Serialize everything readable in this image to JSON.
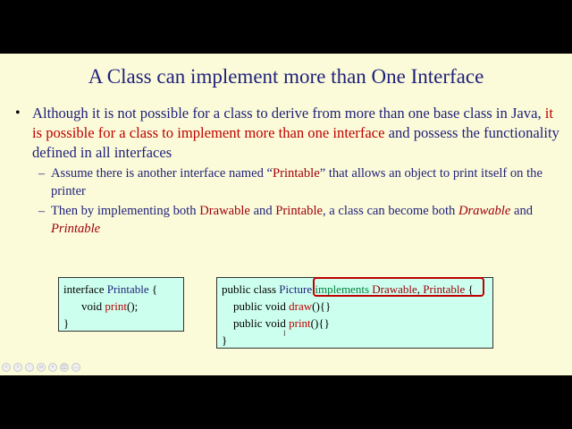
{
  "slide": {
    "title": "A Class can implement more than One Interface",
    "bullet": {
      "marker": "•",
      "part1": "Although it is not possible for a class to derive from more than one base class in Java, ",
      "part2": "it is possible for a class to implement more than one interface",
      "part3": " and possess the functionality defined in all interfaces"
    },
    "sub1": {
      "marker": "–",
      "part1": "Assume there is another interface named “",
      "part2": "Printable",
      "part3": "” that allows an object to print itself on the printer"
    },
    "sub2": {
      "marker": "–",
      "part1": "Then by implementing both ",
      "part2": "Drawable",
      "part3": " and ",
      "part4": "Printable",
      "part5": ", a class can become both ",
      "part6": "Drawable",
      "part7": " and ",
      "part8": "Printable"
    },
    "code_left": {
      "line1_kw": "interface ",
      "line1_name": "Printable",
      "line1_brace": " {",
      "line2_kw": "void ",
      "line2_name": "print",
      "line2_rest": "();",
      "line3": "}"
    },
    "code_right": {
      "line1_kw": "public class ",
      "line1_name": "Picture",
      "line1_impl": "implements ",
      "line1_i1": "Drawable",
      "line1_comma": ", ",
      "line1_i2": "Printable",
      "line1_brace": " {",
      "line2_kw": "public void ",
      "line2_name": "draw",
      "line2_rest": "(){}",
      "line3_kw": "public void ",
      "line3_name": "print",
      "line3_rest": "(){}",
      "line4": "}"
    }
  },
  "toolbar": {
    "icons": [
      "previous-icon",
      "next-icon",
      "pen-icon",
      "slides-icon",
      "zoom-icon",
      "captions-icon",
      "more-icon"
    ]
  },
  "colors": {
    "slide_bg": "#fbfbd9",
    "title": "#1f1f7a",
    "emphasis_red": "#c00000",
    "code_bg": "#ccffee",
    "implements_green": "#008040"
  }
}
